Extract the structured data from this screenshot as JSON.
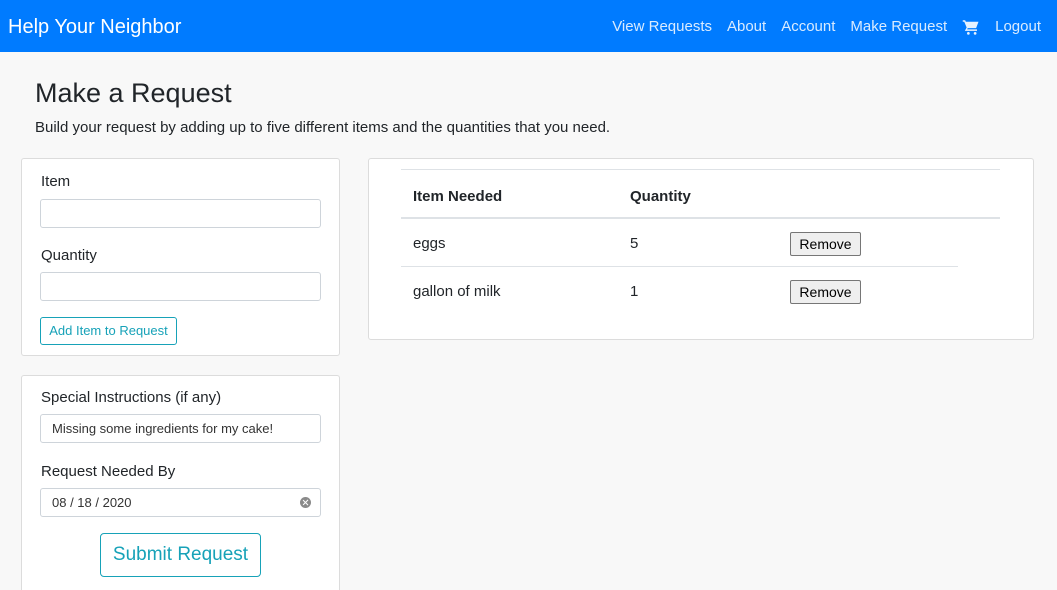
{
  "navbar": {
    "brand": "Help Your Neighbor",
    "links": [
      "View Requests",
      "About",
      "Account",
      "Make Request"
    ],
    "cart_icon": "shopping-cart-icon",
    "logout": "Logout",
    "color": "#007bff"
  },
  "page": {
    "title": "Make a Request",
    "subtitle": "Build your request by adding up to five different items and the quantities that you need."
  },
  "item_form": {
    "item_label": "Item",
    "item_value": "",
    "quantity_label": "Quantity",
    "quantity_value": "",
    "add_button": "Add Item to Request"
  },
  "special_form": {
    "instructions_label": "Special Instructions (if any)",
    "instructions_value": "Missing some ingredients for my cake!",
    "needed_by_label": "Request Needed By",
    "needed_by_value": "08 / 18 / 2020",
    "submit_button": "Submit Request"
  },
  "request_table": {
    "headers": [
      "Item Needed",
      "Quantity"
    ],
    "rows": [
      {
        "item": "eggs",
        "quantity": "5",
        "action": "Remove"
      },
      {
        "item": "gallon of milk",
        "quantity": "1",
        "action": "Remove"
      }
    ]
  },
  "colors": {
    "primary": "#007bff",
    "info": "#17a2b8"
  }
}
